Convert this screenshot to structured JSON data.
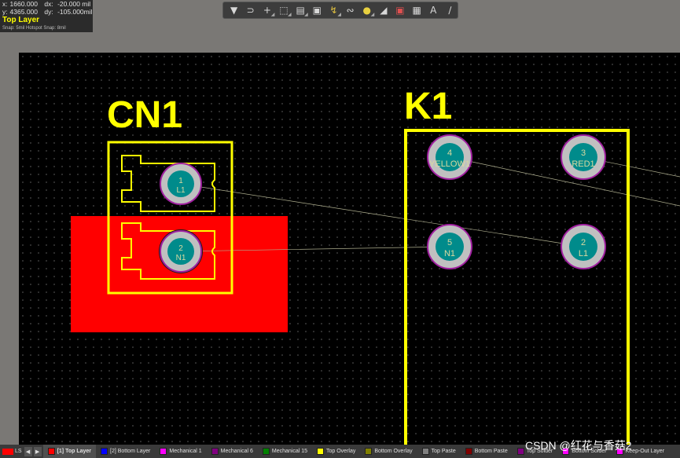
{
  "coords": {
    "x_label": "x:",
    "x_value": "1660.000",
    "dx_label": "dx:",
    "dx_value": "-20.000 mil",
    "y_label": "y:",
    "y_value": "4365.000",
    "dy_label": "dy:",
    "dy_value": "-105.000mil",
    "current_layer": "Top Layer",
    "snap_text": "Snap: 5mil Hotspot Snap: 8mil"
  },
  "toolbar": {
    "tools": [
      "filter-icon",
      "route-magnet-icon",
      "crosshair-add-icon",
      "select-rect-icon",
      "align-chart-icon",
      "component-icon",
      "route-icon",
      "diff-pair-icon",
      "place-pad-icon",
      "polygon-icon",
      "region-icon",
      "dimension-icon",
      "text-icon",
      "line-icon"
    ]
  },
  "components": {
    "cn1": {
      "designator": "CN1",
      "pads": [
        {
          "number": "1",
          "net": "L1"
        },
        {
          "number": "2",
          "net": "N1"
        }
      ]
    },
    "k1": {
      "designator": "K1",
      "pads": [
        {
          "number": "4",
          "net": "YELLOW1"
        },
        {
          "number": "3",
          "net": "RED1"
        },
        {
          "number": "5",
          "net": "N1"
        },
        {
          "number": "2",
          "net": "L1"
        }
      ]
    }
  },
  "layer_tabs": {
    "ls_label": "LS",
    "tabs": [
      {
        "label": "[1] Top Layer",
        "color": "#ff0000",
        "active": true
      },
      {
        "label": "[2] Bottom Layer",
        "color": "#0000ff",
        "active": false
      },
      {
        "label": "Mechanical 1",
        "color": "#ff00ff",
        "active": false
      },
      {
        "label": "Mechanical 6",
        "color": "#800080",
        "active": false
      },
      {
        "label": "Mechanical 15",
        "color": "#008000",
        "active": false
      },
      {
        "label": "Top Overlay",
        "color": "#ffff00",
        "active": false
      },
      {
        "label": "Bottom Overlay",
        "color": "#808000",
        "active": false
      },
      {
        "label": "Top Paste",
        "color": "#808080",
        "active": false
      },
      {
        "label": "Bottom Paste",
        "color": "#800000",
        "active": false
      },
      {
        "label": "Top Solder",
        "color": "#800080",
        "active": false
      },
      {
        "label": "Bottom Solder",
        "color": "#ff00ff",
        "active": false
      },
      {
        "label": "Keep-Out Layer",
        "color": "#ff00ff",
        "active": false
      }
    ]
  },
  "watermark": "CSDN @红花与香菇2",
  "colors": {
    "overlay": "#ffff00",
    "copper": "#ff0000",
    "pad_ring": "#c0c0c0",
    "pad_hole": "#008b8b",
    "pad_outline": "#a020a0",
    "ratsnest": "#b0b090"
  }
}
